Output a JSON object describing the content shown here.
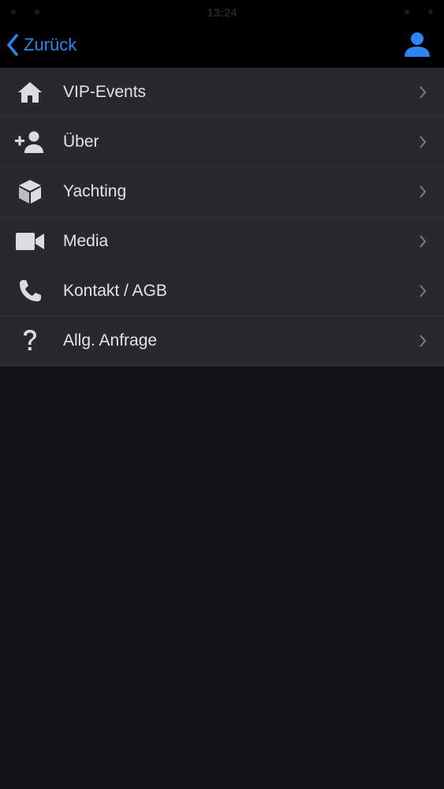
{
  "status_bar": {
    "time": "13:24"
  },
  "nav": {
    "back_label": "Zurück",
    "accent_color": "#2b86f2",
    "profile_icon": "person-icon"
  },
  "menu": {
    "items": [
      {
        "label": "VIP-Events",
        "icon": "home-icon"
      },
      {
        "label": "Über",
        "icon": "add-person-icon"
      },
      {
        "label": "Yachting",
        "icon": "cube-icon"
      },
      {
        "label": "Media",
        "icon": "video-camera-icon"
      },
      {
        "label": "Kontakt / AGB",
        "icon": "phone-icon"
      },
      {
        "label": "Allg. Anfrage",
        "icon": "question-icon"
      }
    ]
  }
}
